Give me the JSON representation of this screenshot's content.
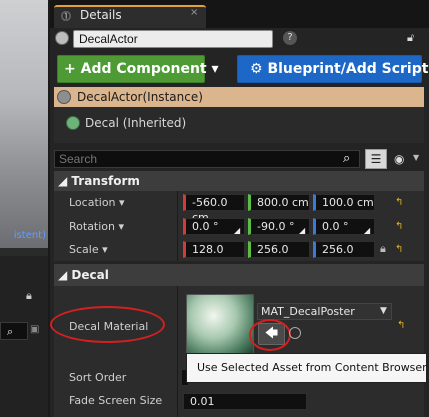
{
  "viewport": {
    "label": "istent)"
  },
  "tab": {
    "label": "Details",
    "close": "×"
  },
  "actor": {
    "name": "DecalActor",
    "help": "?"
  },
  "buttons": {
    "add_component": "+ Add Component ▾",
    "blueprint": "Blueprint/Add Script"
  },
  "components": {
    "instance": "DecalActor(Instance)",
    "decal": "Decal (Inherited)"
  },
  "search": {
    "placeholder": "Search"
  },
  "transform": {
    "header": "Transform",
    "rows": [
      {
        "label": "Location ▾",
        "x": "-560.0 cm",
        "y": "800.0 cm",
        "z": "100.0 cm"
      },
      {
        "label": "Rotation ▾",
        "x": "0.0 °",
        "y": "-90.0 °",
        "z": "0.0 °"
      },
      {
        "label": "Scale ▾",
        "x": "128.0",
        "y": "256.0",
        "z": "256.0"
      }
    ]
  },
  "decal": {
    "header": "Decal",
    "material_label": "Decal Material",
    "material_value": "MAT_DecalPoster",
    "sort_order_label": "Sort Order",
    "fade_label": "Fade Screen Size",
    "fade_value": "0.01",
    "tooltip": "Use Selected Asset from Content Browser"
  },
  "icons": {
    "tab": "details-icon",
    "lock": "lock-icon",
    "search": "search-icon",
    "grid": "grid-view-icon",
    "eye": "eye-icon",
    "reset": "reset-to-default-icon",
    "use_selected": "left-arrow-icon",
    "browse": "browse-icon"
  },
  "colors": {
    "add_component": "#4e9a35",
    "blueprint": "#1d67c6",
    "instance_highlight": "#dbb58e",
    "annotation": "#d42020",
    "axis_x": "#d43a3a",
    "axis_y": "#5bbd45",
    "axis_z": "#3a7ad6"
  }
}
